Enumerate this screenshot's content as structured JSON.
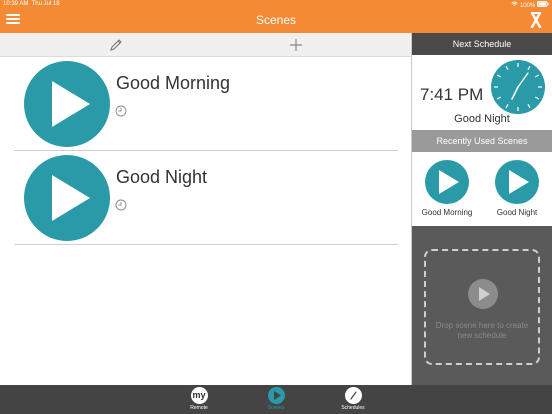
{
  "status_bar": {
    "time": "10:39 AM",
    "date": "Thu Jul 18",
    "battery": "100%"
  },
  "nav": {
    "title": "Scenes",
    "menu_icon": "hamburger-menu-icon",
    "logo_icon": "app-logo-icon"
  },
  "toolbar": {
    "edit_icon": "pencil-icon",
    "add_icon": "plus-icon"
  },
  "scenes": [
    {
      "name": "Good Morning",
      "icon": "play-icon"
    },
    {
      "name": "Good Night",
      "icon": "play-icon"
    }
  ],
  "side": {
    "next_schedule_title": "Next Schedule",
    "next_time": "7:41 PM",
    "next_scene": "Good Night",
    "recent_title": "Recently Used Scenes",
    "recent": [
      "Good Morning",
      "Good Night"
    ],
    "drop_text": "Drop scene here to create new schedule"
  },
  "tabs": [
    {
      "label": "Remote",
      "icon_text": "my",
      "active": false
    },
    {
      "label": "Scenes",
      "active": true
    },
    {
      "label": "Schedules",
      "active": false
    }
  ],
  "colors": {
    "accent_orange": "#f48a34",
    "teal": "#2a9aa8",
    "side_dark": "#5a5a5a",
    "tabbar": "#444444"
  }
}
